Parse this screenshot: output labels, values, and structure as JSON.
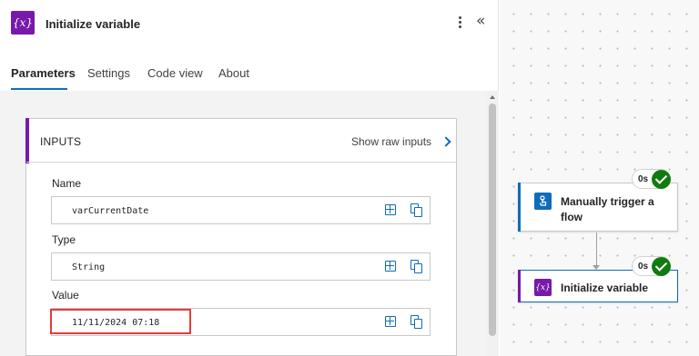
{
  "header": {
    "icon_glyph": "{x}",
    "icon_name": "variable-icon",
    "title": "Initialize variable"
  },
  "tabs": [
    {
      "label": "Parameters",
      "active": true
    },
    {
      "label": "Settings",
      "active": false
    },
    {
      "label": "Code view",
      "active": false
    },
    {
      "label": "About",
      "active": false
    }
  ],
  "inputs": {
    "title": "INPUTS",
    "show_raw_label": "Show raw inputs",
    "fields": [
      {
        "label": "Name",
        "value": "varCurrentDate"
      },
      {
        "label": "Type",
        "value": "String"
      },
      {
        "label": "Value",
        "value": "11/11/2024 07:18"
      }
    ]
  },
  "flow": {
    "nodes": [
      {
        "label_line1": "Manually trigger a",
        "label_line2": "flow",
        "duration": "0s",
        "status": "succeeded",
        "icon": "touch-icon"
      },
      {
        "label_line1": "Initialize variable",
        "label_line2": "",
        "duration": "0s",
        "status": "succeeded",
        "icon": "variable-icon",
        "icon_glyph": "{x}"
      }
    ]
  },
  "colors": {
    "accent_purple": "#7719aa",
    "trigger_blue": "#0f6cbd",
    "success_green": "#107c10",
    "highlight_red": "#e63b3b"
  }
}
